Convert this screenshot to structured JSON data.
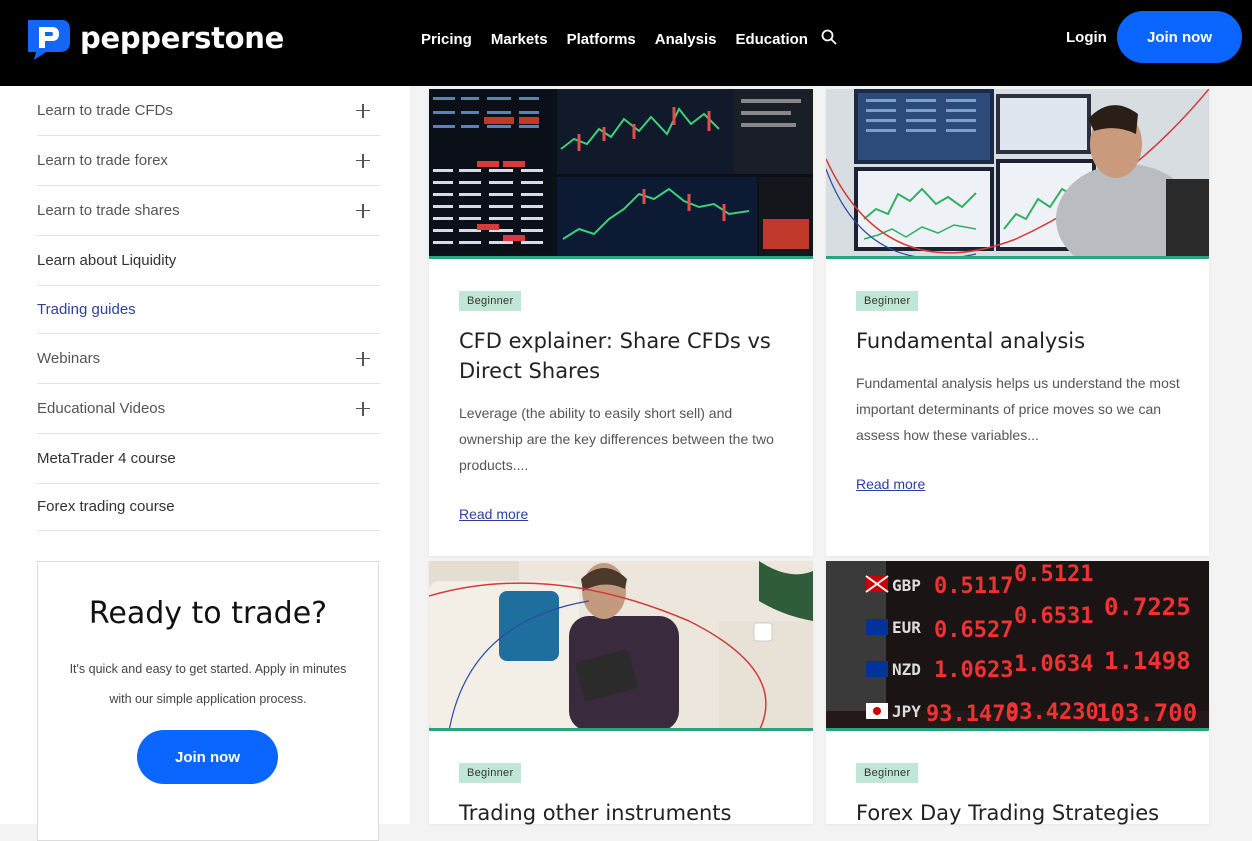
{
  "header": {
    "logo_text": "pepperstone",
    "nav": [
      "Pricing",
      "Markets",
      "Platforms",
      "Analysis",
      "Education"
    ],
    "login": "Login",
    "join": "Join now"
  },
  "sidebar": {
    "items": [
      {
        "label": "Learn to trade CFDs",
        "expandable": true,
        "style": "muted"
      },
      {
        "label": "Learn to trade forex",
        "expandable": true,
        "style": "muted"
      },
      {
        "label": "Learn to trade shares",
        "expandable": true,
        "style": "muted"
      },
      {
        "label": "Learn about Liquidity",
        "expandable": false,
        "style": "normal"
      },
      {
        "label": "Trading guides",
        "expandable": false,
        "style": "active"
      },
      {
        "label": "Webinars",
        "expandable": true,
        "style": "muted"
      },
      {
        "label": "Educational Videos",
        "expandable": true,
        "style": "muted"
      },
      {
        "label": "MetaTrader 4 course",
        "expandable": false,
        "style": "normal"
      },
      {
        "label": "Forex trading course",
        "expandable": false,
        "style": "normal"
      }
    ]
  },
  "ready": {
    "title": "Ready to trade?",
    "text": "It's quick and easy to get started. Apply in minutes with our simple application process.",
    "button": "Join now"
  },
  "cards": [
    {
      "badge": "Beginner",
      "title": "CFD explainer: Share CFDs vs Direct Shares",
      "desc": "Leverage (the ability to easily short sell) and ownership are the key differences between the two products....",
      "link": "Read more"
    },
    {
      "badge": "Beginner",
      "title": "Fundamental analysis",
      "desc": "Fundamental analysis helps us understand the most important determinants of price moves so we can assess how these variables...",
      "link": "Read more"
    },
    {
      "badge": "Beginner",
      "title": "Trading other instruments",
      "desc": "",
      "link": ""
    },
    {
      "badge": "Beginner",
      "title": "Forex Day Trading Strategies",
      "desc": "",
      "link": ""
    }
  ],
  "fx_board": {
    "rows": [
      {
        "ccy": "GBP",
        "vals": [
          "0.5117",
          "0.5121"
        ]
      },
      {
        "ccy": "EUR",
        "vals": [
          "0.6527",
          "0.6531",
          "0.7225"
        ]
      },
      {
        "ccy": "NZD",
        "vals": [
          "1.0623",
          "1.0634",
          "1.1498"
        ]
      },
      {
        "ccy": "JPY",
        "vals": [
          "93.1470",
          "93.4230",
          "103.700"
        ]
      }
    ]
  },
  "colors": {
    "accent": "#0b66ff",
    "badge_bg": "#bfe6d6",
    "card_border": "#2aa27f",
    "active_link": "#2e3fa0"
  }
}
